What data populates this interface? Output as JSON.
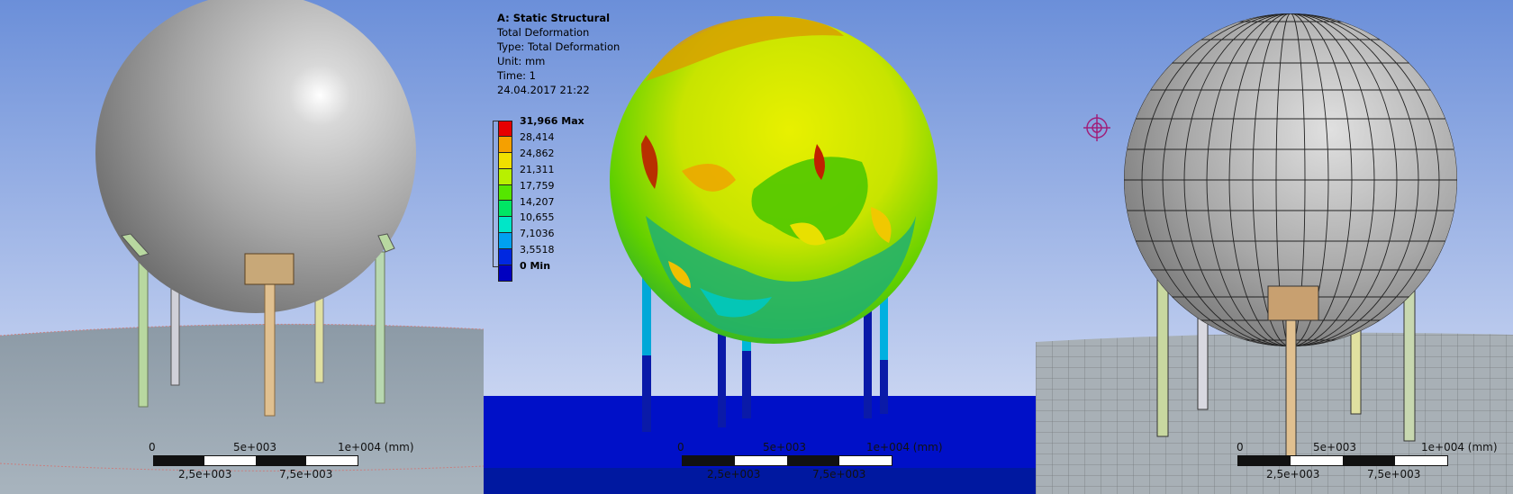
{
  "result_header": {
    "analysis": "A: Static Structural",
    "result_name": "Total Deformation",
    "type": "Type: Total Deformation",
    "unit": "Unit: mm",
    "time": "Time: 1",
    "date": "24.04.2017 21:22"
  },
  "legend": {
    "entries": [
      {
        "label": "31,966 Max",
        "color": "#e60000",
        "bold": true
      },
      {
        "label": "28,414",
        "color": "#f5a000"
      },
      {
        "label": "24,862",
        "color": "#f0e000"
      },
      {
        "label": "21,311",
        "color": "#b8f000"
      },
      {
        "label": "17,759",
        "color": "#55e600"
      },
      {
        "label": "14,207",
        "color": "#00e664"
      },
      {
        "label": "10,655",
        "color": "#00e6c8"
      },
      {
        "label": "7,1036",
        "color": "#00a0f0"
      },
      {
        "label": "3,5518",
        "color": "#0028e0"
      },
      {
        "label": "0 Min",
        "color": "#0000c0",
        "bold": true
      }
    ]
  },
  "scale_bars": {
    "panel1": {
      "top": [
        "0",
        "5e+003",
        "1e+004 (mm)"
      ],
      "bottom": [
        "2,5e+003",
        "7,5e+003"
      ]
    },
    "panel2": {
      "top": [
        "0",
        "5e+003",
        "1e+004 (mm)"
      ],
      "bottom": [
        "2,5e+003",
        "7,5e+003"
      ]
    },
    "panel3": {
      "top": [
        "0",
        "5e+003",
        "1e+004 (mm)"
      ],
      "bottom": [
        "2,5e+003",
        "7,5e+003"
      ]
    }
  },
  "colors": {
    "background_top": "#6b8fd9",
    "background_bottom": "#d9e0f5",
    "ground_blue": "#0010c8"
  }
}
